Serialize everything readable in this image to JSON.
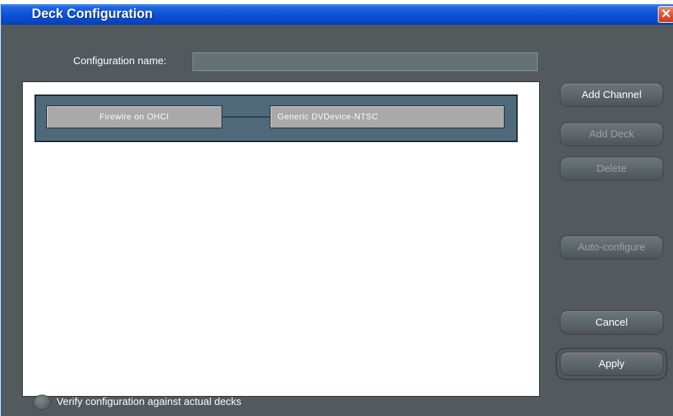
{
  "window": {
    "title": "Deck Configuration"
  },
  "form": {
    "config_name_label": "Configuration name:",
    "config_name_value": ""
  },
  "diagram": {
    "channel": {
      "source_label": "Firewire on OHCI",
      "deck_label": "Generic DVDevice-NTSC"
    }
  },
  "buttons": {
    "add_channel": "Add Channel",
    "add_deck": "Add Deck",
    "delete": "Delete",
    "auto_configure": "Auto-configure",
    "cancel": "Cancel",
    "apply": "Apply"
  },
  "verify": {
    "label": "Verify configuration against actual decks",
    "checked": false
  },
  "icons": {
    "close": "close-icon"
  },
  "colors": {
    "dialog_bg": "#525a5e",
    "titlebar": "#0a4fd6",
    "channel_bg": "#4e6a7a",
    "node_bg": "#a9a9a9",
    "close_button": "#d8502d"
  }
}
